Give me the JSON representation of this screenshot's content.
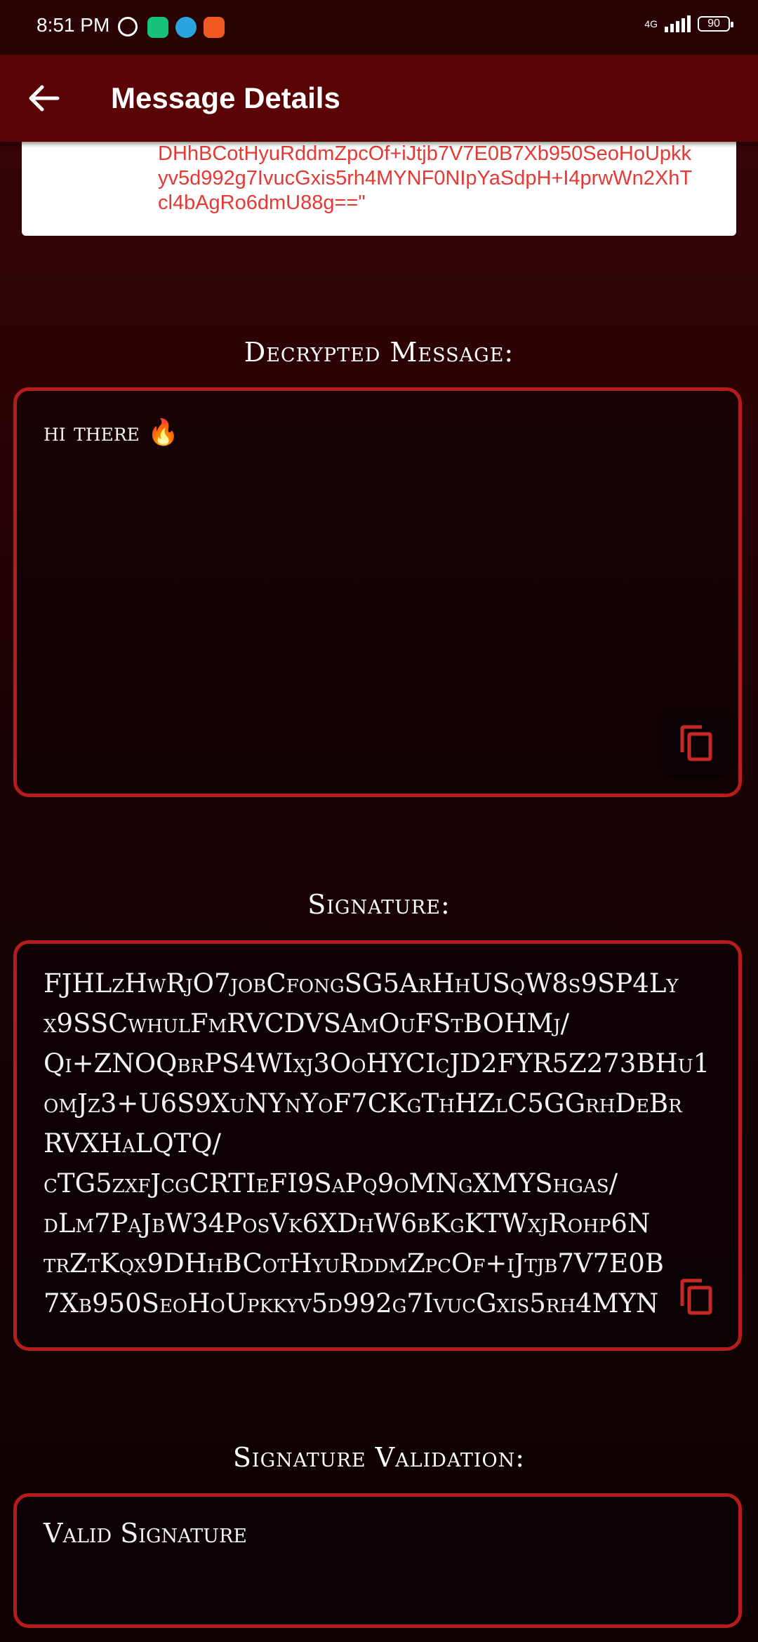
{
  "status_bar": {
    "time": "8:51 PM",
    "network": "4G",
    "battery": "90"
  },
  "app_bar": {
    "title": "Message Details",
    "back_icon": "arrow-back-icon"
  },
  "encrypted_card": {
    "visible_text": "DHhBCotHyuRddmZpcOf+iJtjb7V7E0B7Xb950SeoHoUpkk\nyv5d992g7IvucGxis5rh4MYNF0NIpYaSdpH+I4prwWn2XhT\ncl4bAgRo6dmU88g==\""
  },
  "decrypted": {
    "title": "Decrypted Message:",
    "text": "hi there 🔥",
    "copy_icon": "copy-icon"
  },
  "signature": {
    "title": "Signature:",
    "text": "FJHLzHwRjO7jobCfongSG5ArHhUSqW8s9SP4Ly\nx9SSCwhulFmRVCDVSAmOuFStBOHMj/\nQi+ZNOQbrPS4WIxj3OoHYCIcJD2FYR5Z273BHu1\nomJz3+U6S9XuNYnYoF7CKgThHZlC5GGrhDeBr\nRVXHaLQTQ/\ncTG5zxfJcgCRTIeFI9SaPq9oMNgXMYShgas/\ndLm7PaJbW34PosVk6XDhW6bKgKTWxjRohp6N\ntrZtKqx9DHhBCotHyuRddmZpcOf+iJtjb7V7E0B\n7Xb950SeoHoUpkkyv5d992g7IvucGxis5rh4MYN",
    "copy_icon": "copy-icon"
  },
  "validation": {
    "title": "Signature Validation:",
    "text": "Valid Signature"
  },
  "colors": {
    "accent": "#b71c1c",
    "app_bar": "#5a0406",
    "encrypted_text": "#e53935"
  }
}
